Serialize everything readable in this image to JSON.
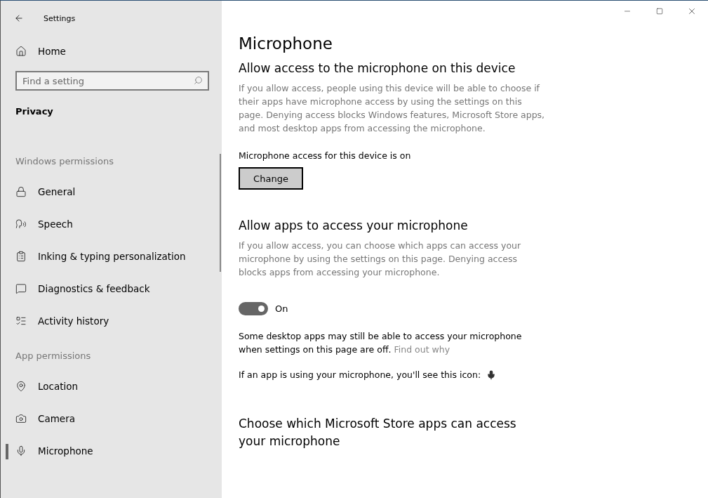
{
  "window": {
    "title": "Settings"
  },
  "sidebar": {
    "home": "Home",
    "search": {
      "placeholder": "Find a setting"
    },
    "section_title": "Privacy",
    "groups": [
      {
        "heading": "Windows permissions",
        "items": [
          {
            "label": "General",
            "selected": false
          },
          {
            "label": "Speech",
            "selected": false
          },
          {
            "label": "Inking & typing personalization",
            "selected": false
          },
          {
            "label": "Diagnostics & feedback",
            "selected": false
          },
          {
            "label": "Activity history",
            "selected": false
          }
        ]
      },
      {
        "heading": "App permissions",
        "items": [
          {
            "label": "Location",
            "selected": false
          },
          {
            "label": "Camera",
            "selected": false
          },
          {
            "label": "Microphone",
            "selected": true
          }
        ]
      }
    ]
  },
  "main": {
    "title": "Microphone",
    "device_section": {
      "heading": "Allow access to the microphone on this device",
      "description": "If you allow access, people using this device will be able to choose if their apps have microphone access by using the settings on this page. Denying access blocks Windows features, Microsoft Store apps, and most desktop apps from accessing the microphone.",
      "status": "Microphone access for this device is on",
      "button": "Change"
    },
    "apps_section": {
      "heading": "Allow apps to access your microphone",
      "description": "If you allow access, you can choose which apps can access your microphone by using the settings on this page. Denying access blocks apps from accessing your microphone.",
      "toggle": {
        "on": true,
        "label": "On"
      },
      "note": "Some desktop apps may still be able to access your microphone when settings on this page are off.",
      "note_link": "Find out why",
      "icon_note": "If an app is using your microphone, you'll see this icon:"
    },
    "store_section": {
      "heading": "Choose which Microsoft Store apps can access your microphone"
    }
  }
}
